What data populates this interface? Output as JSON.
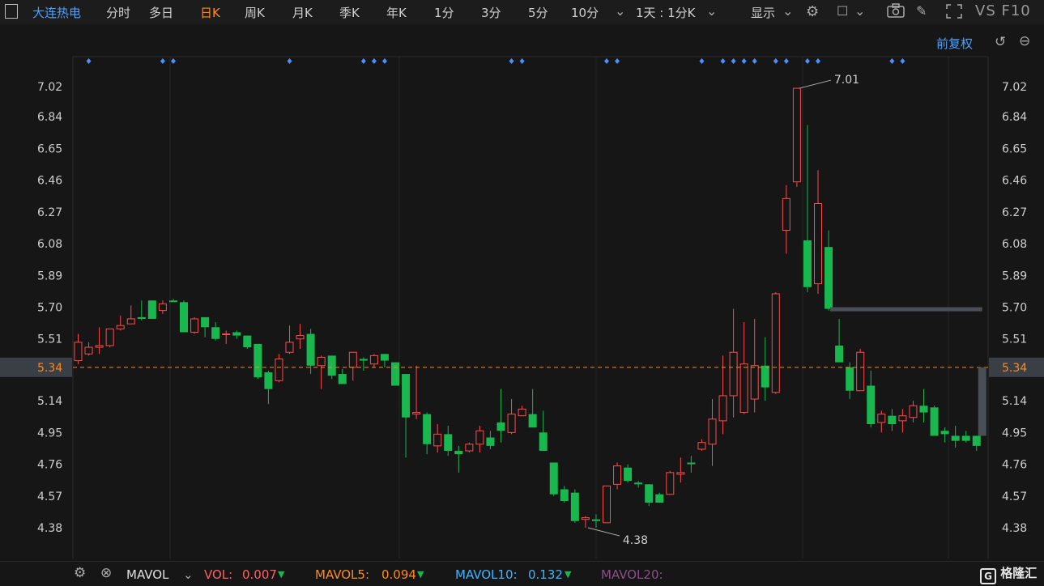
{
  "toolbar": {
    "stock_name": "大连热电",
    "periods": [
      "分时",
      "多日",
      "日K",
      "周K",
      "月K",
      "季K",
      "年K",
      "1分",
      "3分",
      "5分",
      "10分"
    ],
    "active_period": "日K",
    "range_select": "1天 : 1分K",
    "display_label": "显示",
    "vs_label": "VS",
    "f10_label": "F10"
  },
  "adjust_label": "前复权",
  "chart_data": {
    "type": "candlestick",
    "y_ticks": [
      "7.02",
      "6.84",
      "6.65",
      "6.46",
      "6.27",
      "6.08",
      "5.89",
      "5.70",
      "5.51",
      "5.34",
      "5.14",
      "4.95",
      "4.76",
      "4.57",
      "4.38"
    ],
    "ylim": [
      4.22,
      7.24
    ],
    "current_price": "5.34",
    "max_label": "7.01",
    "min_label": "4.38",
    "candles": [
      [
        5.38,
        5.49,
        5.36,
        5.54
      ],
      [
        5.42,
        5.46,
        5.41,
        5.49
      ],
      [
        5.46,
        5.47,
        5.42,
        5.58
      ],
      [
        5.47,
        5.57,
        5.46,
        5.57
      ],
      [
        5.57,
        5.59,
        5.56,
        5.65
      ],
      [
        5.6,
        5.63,
        5.6,
        5.71
      ],
      [
        5.64,
        5.63,
        5.62,
        5.74
      ],
      [
        5.74,
        5.63,
        5.63,
        5.74
      ],
      [
        5.68,
        5.72,
        5.66,
        5.74
      ],
      [
        5.74,
        5.73,
        5.73,
        5.75
      ],
      [
        5.73,
        5.55,
        5.55,
        5.74
      ],
      [
        5.55,
        5.63,
        5.54,
        5.64
      ],
      [
        5.64,
        5.58,
        5.52,
        5.64
      ],
      [
        5.58,
        5.51,
        5.5,
        5.61
      ],
      [
        5.54,
        5.54,
        5.48,
        5.56
      ],
      [
        5.55,
        5.53,
        5.51,
        5.56
      ],
      [
        5.53,
        5.46,
        5.45,
        5.53
      ],
      [
        5.48,
        5.28,
        5.27,
        5.48
      ],
      [
        5.31,
        5.21,
        5.12,
        5.32
      ],
      [
        5.26,
        5.39,
        5.25,
        5.42
      ],
      [
        5.43,
        5.49,
        5.42,
        5.59
      ],
      [
        5.51,
        5.53,
        5.45,
        5.6
      ],
      [
        5.54,
        5.35,
        5.3,
        5.57
      ],
      [
        5.35,
        5.4,
        5.21,
        5.41
      ],
      [
        5.41,
        5.29,
        5.27,
        5.41
      ],
      [
        5.3,
        5.24,
        5.24,
        5.33
      ],
      [
        5.34,
        5.43,
        5.26,
        5.43
      ],
      [
        5.39,
        5.38,
        5.32,
        5.4
      ],
      [
        5.36,
        5.41,
        5.34,
        5.42
      ],
      [
        5.42,
        5.38,
        5.34,
        5.42
      ],
      [
        5.37,
        5.23,
        5.23,
        5.36
      ],
      [
        5.3,
        5.04,
        4.8,
        5.06
      ],
      [
        5.06,
        5.07,
        5.03,
        5.35
      ],
      [
        5.06,
        4.88,
        4.82,
        5.07
      ],
      [
        4.87,
        4.94,
        4.83,
        5.0
      ],
      [
        4.94,
        4.84,
        4.81,
        4.99
      ],
      [
        4.84,
        4.82,
        4.71,
        4.87
      ],
      [
        4.84,
        4.88,
        4.83,
        4.89
      ],
      [
        4.88,
        4.96,
        4.83,
        4.99
      ],
      [
        4.92,
        4.87,
        4.85,
        4.96
      ],
      [
        5.01,
        4.96,
        4.89,
        5.21
      ],
      [
        4.95,
        5.06,
        4.94,
        5.15
      ],
      [
        5.05,
        5.09,
        5.06,
        5.11
      ],
      [
        5.06,
        4.98,
        4.99,
        5.21
      ],
      [
        4.95,
        4.84,
        4.84,
        5.08
      ],
      [
        4.77,
        4.58,
        4.57,
        4.76
      ],
      [
        4.61,
        4.54,
        4.53,
        4.63
      ],
      [
        4.59,
        4.42,
        4.41,
        4.61
      ],
      [
        4.43,
        4.44,
        4.38,
        4.45
      ],
      [
        4.43,
        4.42,
        4.38,
        4.46
      ],
      [
        4.41,
        4.63,
        4.41,
        4.63
      ],
      [
        4.64,
        4.75,
        4.61,
        4.77
      ],
      [
        4.74,
        4.66,
        4.65,
        4.76
      ],
      [
        4.65,
        4.64,
        4.62,
        4.66
      ],
      [
        4.64,
        4.53,
        4.51,
        4.64
      ],
      [
        4.58,
        4.53,
        4.53,
        4.59
      ],
      [
        4.58,
        4.71,
        4.58,
        4.72
      ],
      [
        4.7,
        4.71,
        4.65,
        4.8
      ],
      [
        4.77,
        4.76,
        4.71,
        4.81
      ],
      [
        4.85,
        4.89,
        4.84,
        4.91
      ],
      [
        4.88,
        5.03,
        4.75,
        5.15
      ],
      [
        5.02,
        5.17,
        4.94,
        5.41
      ],
      [
        5.17,
        5.43,
        5.04,
        5.69
      ],
      [
        5.07,
        5.36,
        5.06,
        5.61
      ],
      [
        5.15,
        5.35,
        5.07,
        5.63
      ],
      [
        5.35,
        5.22,
        5.14,
        5.52
      ],
      [
        5.19,
        5.78,
        5.18,
        5.79
      ],
      [
        6.16,
        6.35,
        6.02,
        6.43
      ],
      [
        6.45,
        7.01,
        6.42,
        7.01
      ],
      [
        6.1,
        5.82,
        5.79,
        6.79
      ],
      [
        5.84,
        6.32,
        5.78,
        6.52
      ],
      [
        6.06,
        5.69,
        5.68,
        6.16
      ],
      [
        5.47,
        5.37,
        5.37,
        5.63
      ],
      [
        5.34,
        5.2,
        5.15,
        5.37
      ],
      [
        5.2,
        5.43,
        5.2,
        5.45
      ],
      [
        5.23,
        5.0,
        4.98,
        5.32
      ],
      [
        5.01,
        5.06,
        4.95,
        5.08
      ],
      [
        5.05,
        5.0,
        4.96,
        5.09
      ],
      [
        5.02,
        5.05,
        4.95,
        5.09
      ],
      [
        5.04,
        5.11,
        5.01,
        5.14
      ],
      [
        5.11,
        5.07,
        5.01,
        5.21
      ],
      [
        5.1,
        4.93,
        4.93,
        5.11
      ],
      [
        4.96,
        4.94,
        4.89,
        4.98
      ],
      [
        4.93,
        4.9,
        4.86,
        4.99
      ],
      [
        4.93,
        4.9,
        4.89,
        4.96
      ],
      [
        4.93,
        4.87,
        4.84,
        4.93
      ]
    ],
    "marker_indices": [
      1,
      8,
      9,
      20,
      27,
      28,
      29,
      41,
      42,
      50,
      51,
      59,
      61,
      62,
      63,
      64,
      66,
      67,
      69,
      70,
      77,
      78
    ]
  },
  "indicator_bar": {
    "name": "MAVOL",
    "vol_label": "VOL:",
    "vol_value": "0.007",
    "mavol5_label": "MAVOL5:",
    "mavol5_value": "0.094",
    "mavol10_label": "MAVOL10:",
    "mavol10_value": "0.132",
    "mavol20_label": "MAVOL20:"
  },
  "colors": {
    "up": "#ff4a4a",
    "down": "#18b84f",
    "accent": "#ff8a1a",
    "link": "#4ea0ff",
    "marker": "#4b8fff"
  },
  "brand": "格隆汇"
}
